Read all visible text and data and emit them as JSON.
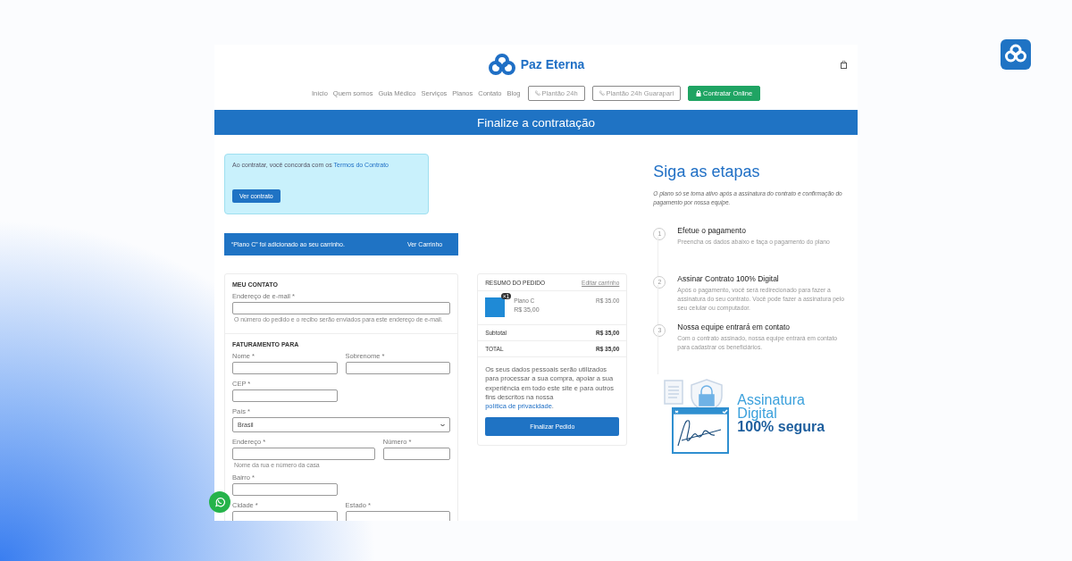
{
  "header": {
    "brand": "Paz Eterna",
    "nav_links": [
      "Início",
      "Quem somos",
      "Guia Médico",
      "Serviços",
      "Planos",
      "Contato",
      "Blog"
    ],
    "nav_buttons": [
      {
        "kind": "outline",
        "label": "Plantão 24h"
      },
      {
        "kind": "outline",
        "label": "Plantão 24h Guarapari"
      },
      {
        "kind": "primary",
        "label": "Contratar Online"
      }
    ]
  },
  "page_title": "Finalize a contratação",
  "notice": {
    "text": "Ao contratar, você concorda com os ",
    "link": "Termos do Contrato",
    "button": "Ver contrato"
  },
  "cart_message": {
    "text": "“Plano C” foi adicionado ao seu carrinho.",
    "link": "Ver Carrinho"
  },
  "form": {
    "sections": [
      {
        "title": "MEU CONTATO",
        "fields": [
          {
            "kind": "text",
            "label": "Endereço de e-mail *",
            "hint": "O número do pedido e o recibo serão enviados para este endereço de e-mail."
          }
        ]
      },
      {
        "title": "FATURAMENTO PARA",
        "fields": [
          {
            "kind": "text",
            "label": "Nome *"
          },
          {
            "kind": "text",
            "label": "Sobrenome *"
          },
          {
            "kind": "text",
            "label": "CEP *"
          },
          {
            "kind": "select",
            "label": "País *",
            "value": "Brasil"
          },
          {
            "kind": "text",
            "label": "Endereço *",
            "hint": "Nome da rua e número da casa"
          },
          {
            "kind": "text",
            "label": "Número *"
          },
          {
            "kind": "text",
            "label": "Bairro *"
          },
          {
            "kind": "text",
            "label": "Cidade *"
          },
          {
            "kind": "text",
            "label": "Estado *"
          }
        ]
      }
    ]
  },
  "summary": {
    "title": "RESUMO DO PEDIDO",
    "edit_link": "Editar carrinho",
    "item": {
      "quantity": "×1",
      "name": "Plano C",
      "unit_price": "R$ 35,00",
      "price": "R$ 35.00"
    },
    "rows": [
      {
        "label": "Subtotal",
        "value": "R$ 35,00"
      },
      {
        "label": "TOTAL",
        "value": "R$ 35,00"
      }
    ],
    "privacy_text": "Os seus dados pessoais serão utilizados para processar a sua compra, apoiar a sua experiência em todo este site e para outros fins descritos na nossa ",
    "privacy_link": "política de privacidade",
    "privacy_end": ".",
    "button": "Finalizar Pedido"
  },
  "steps": {
    "title": "Siga as etapas",
    "subtitle": "O plano só se torna ativo após a assinatura do contrato e confirmação do pagamento por nossa equipe.",
    "items": [
      {
        "number": "1",
        "title": "Efetue o pagamento",
        "text": "Preencha os dados abaixo e faça o pagamento do plano"
      },
      {
        "number": "2",
        "title": "Assinar Contrato 100% Digital",
        "text": "Após o pagamento, você será redirecionado para fazer a assinatura do seu contrato. Você pode fazer a assinatura pelo seu celular ou computador."
      },
      {
        "number": "3",
        "title": "Nossa equipe entrará em contato",
        "text": "Com o contrato assinado, nossa equipe entrará em contato para cadastrar os beneficiários."
      }
    ],
    "badge": {
      "line_1": "Assinatura",
      "line_2": "Digital",
      "line_3": "100% segura"
    }
  }
}
